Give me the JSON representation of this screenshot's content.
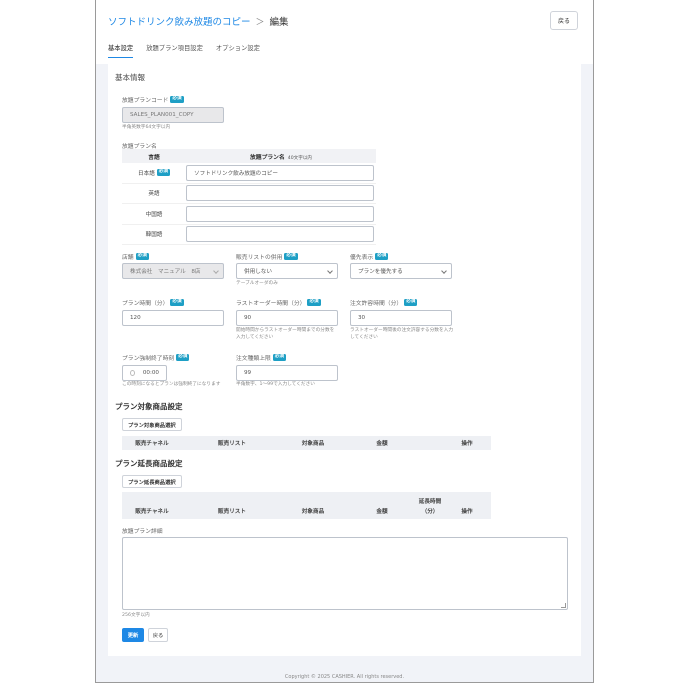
{
  "header": {
    "breadcrumb_parent": "ソフトドリンク飲み放題のコピー",
    "breadcrumb_sep": "＞",
    "breadcrumb_current": "編集",
    "back_label": "戻る"
  },
  "tabs": [
    {
      "label": "基本設定",
      "active": true
    },
    {
      "label": "放題プラン項目設定",
      "active": false
    },
    {
      "label": "オプション設定",
      "active": false
    }
  ],
  "required_label": "必須",
  "section_basic": "基本情報",
  "plan_code": {
    "label": "放題プランコード",
    "value": "SALES_PLAN001_COPY",
    "hint": "半角英数字64文字以内"
  },
  "plan_name": {
    "label": "放題プラン名",
    "col_lang": "言語",
    "col_name": "放題プラン名",
    "col_name_hint": "40文字以内",
    "rows": [
      {
        "lang": "日本語",
        "required": true,
        "value": "ソフトドリンク飲み放題のコピー"
      },
      {
        "lang": "英語",
        "required": false,
        "value": ""
      },
      {
        "lang": "中国語",
        "required": false,
        "value": ""
      },
      {
        "lang": "韓国語",
        "required": false,
        "value": ""
      }
    ]
  },
  "store": {
    "label": "店舗",
    "value": "株式会社　マニュアル　8店"
  },
  "sales_list": {
    "label": "販売リストの併用",
    "value": "併用しない",
    "hint": "テーブルオーダのみ"
  },
  "priority": {
    "label": "優先表示",
    "value": "プランを優先する"
  },
  "plan_time": {
    "label": "プラン時間（分）",
    "value": "120"
  },
  "last_order": {
    "label": "ラストオーダー時間（分）",
    "value": "90",
    "hint": "開始時間からラストオーダー時間までの分数を入力してください"
  },
  "order_allow": {
    "label": "注文許容時間（分）",
    "value": "30",
    "hint": "ラストオーダー時間後の注文許容する分数を入力してください"
  },
  "force_end": {
    "label": "プラン強制終了時刻",
    "value": "00:00",
    "hint": "この時刻になるとプランは強制終了になります"
  },
  "order_limit": {
    "label": "注文種類上限",
    "value": "99",
    "hint": "半角数字、1〜99で入力してください"
  },
  "target_products": {
    "title": "プラン対象商品設定",
    "button": "プラン対象商品選択",
    "columns": [
      "販売チャネル",
      "販売リスト",
      "対象商品",
      "金額",
      "操作"
    ]
  },
  "extension_products": {
    "title": "プラン延長商品設定",
    "button": "プラン延長商品選択",
    "columns": [
      "販売チャネル",
      "販売リスト",
      "対象商品",
      "金額",
      "延長時間",
      "（分）",
      "操作"
    ]
  },
  "details": {
    "label": "放題プラン詳細",
    "hint": "256文字以内"
  },
  "actions": {
    "update": "更新",
    "back": "戻る"
  },
  "footer": "Copyright © 2025 CASHIER. All rights reserved."
}
